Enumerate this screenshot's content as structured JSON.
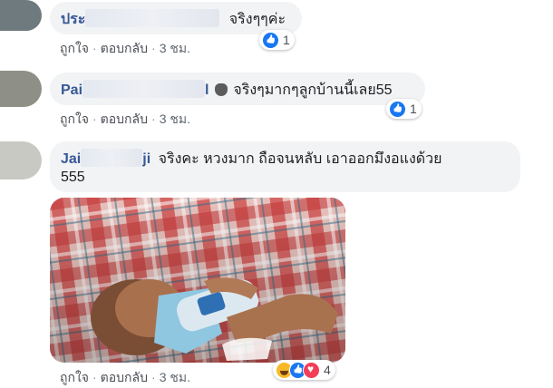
{
  "comments": [
    {
      "name_visible": "ประ",
      "text": "จริงๆๆค่ะ",
      "actions": {
        "like": "ถูกใจ",
        "reply": "ตอบกลับ",
        "time": "3 ชม."
      },
      "reaction_count": "1",
      "reaction_icons": [
        "like-icon"
      ]
    },
    {
      "name_visible": "Pai",
      "name_suffix": "l",
      "emoji": "wave-hand-icon",
      "text": "จริงๆมากๆลูกบ้านนี้เลย55",
      "actions": {
        "like": "ถูกใจ",
        "reply": "ตอบกลับ",
        "time": "3 ชม."
      },
      "reaction_count": "1",
      "reaction_icons": [
        "like-icon"
      ]
    },
    {
      "name_visible": "Jai",
      "name_suffix": "ji",
      "text": "จริงคะ หวงมาก ถือจนหลับ เอาออกมึงอแงด้วย",
      "text_line2": "555",
      "photo": "baby-hugging-water-bottle-photo",
      "actions": {
        "like": "ถูกใจ",
        "reply": "ตอบกลับ",
        "time": "3 ชม."
      },
      "reaction_count": "4",
      "reaction_icons": [
        "haha-icon",
        "like-icon",
        "love-icon"
      ]
    }
  ],
  "colors": {
    "bubble": "#f2f3f5",
    "name": "#385898",
    "meta": "#606770",
    "like": "#1877f2",
    "love": "#f33e58",
    "haha": "#f7b928"
  }
}
